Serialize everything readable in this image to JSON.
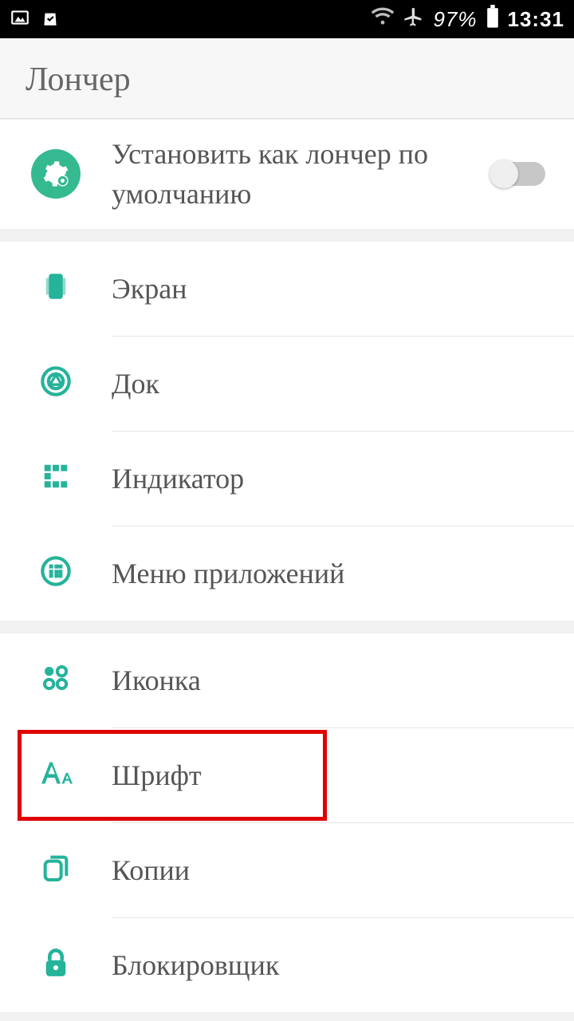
{
  "statusbar": {
    "battery_pct": "97%",
    "time": "13:31"
  },
  "header": {
    "title": "Лончер"
  },
  "default_launcher": {
    "label": "Установить как лончер по умолчанию",
    "enabled": false
  },
  "group_display": [
    {
      "key": "screen",
      "label": "Экран",
      "icon": "screen-icon"
    },
    {
      "key": "dock",
      "label": "Док",
      "icon": "dock-icon"
    },
    {
      "key": "indicator",
      "label": "Индикатор",
      "icon": "indicator-icon"
    },
    {
      "key": "appmenu",
      "label": "Меню приложений",
      "icon": "appmenu-icon"
    }
  ],
  "group_other": [
    {
      "key": "icon",
      "label": "Иконка",
      "icon": "shapes-icon"
    },
    {
      "key": "font",
      "label": "Шрифт",
      "icon": "font-icon",
      "highlighted": true
    },
    {
      "key": "copies",
      "label": "Копии",
      "icon": "copies-icon"
    },
    {
      "key": "blocker",
      "label": "Блокировщик",
      "icon": "lock-icon"
    }
  ],
  "colors": {
    "accent": "#25b39a",
    "accent_dark": "#34b991",
    "text": "#555555",
    "highlight": "#e00000"
  }
}
